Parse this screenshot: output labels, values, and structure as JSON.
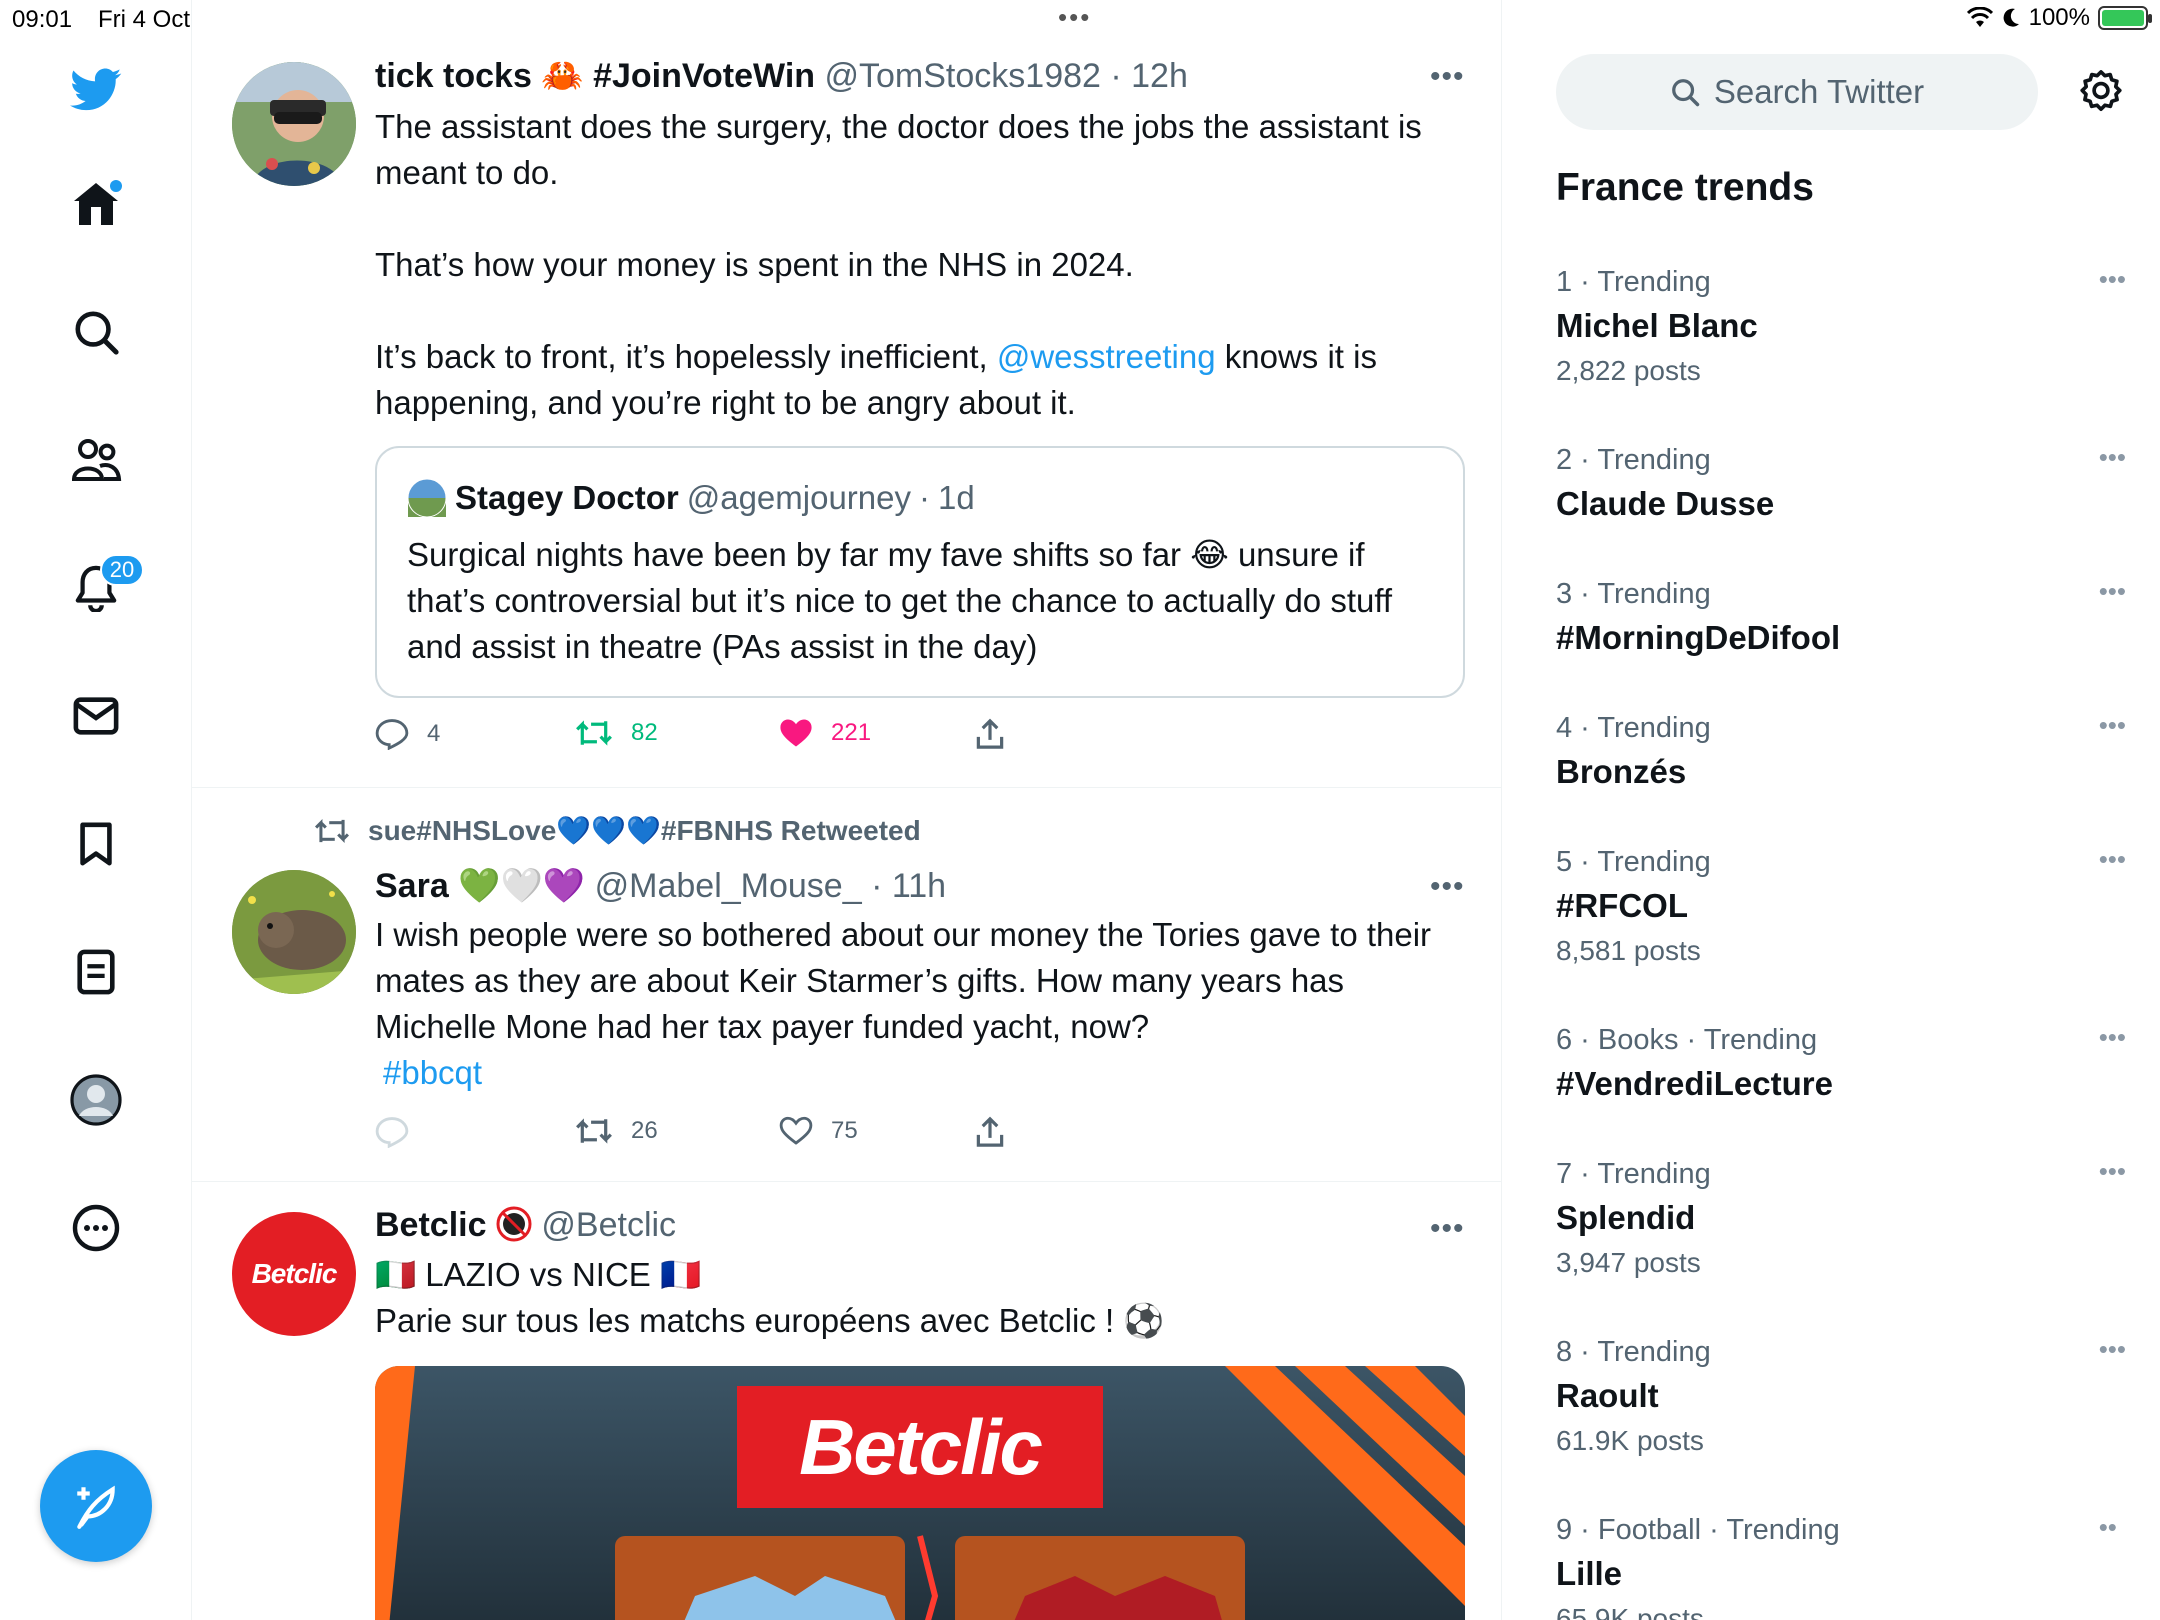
{
  "status_bar": {
    "time": "09:01",
    "date": "Fri 4 Oct",
    "battery": "100%",
    "battery_level": 1.0
  },
  "nav": {
    "notifications_badge": "20",
    "items": [
      "home-icon",
      "explore-icon",
      "communities-icon",
      "notifications-icon",
      "messages-icon",
      "bookmarks-icon",
      "lists-icon",
      "profile-icon",
      "more-icon"
    ]
  },
  "tweets": [
    {
      "name": "tick tocks 🦀 #JoinVoteWin",
      "handle": "@TomStocks1982",
      "time": "12h",
      "text_1": "The assistant does the surgery, the doctor does the jobs the assistant is meant to do.",
      "text_2": "That’s how your money is spent in the NHS in 2024.",
      "text_3a": "It’s back to front, it’s hopelessly inefficient, ",
      "mention": "@wesstreeting",
      "text_3b": " knows it is happening, and you’re right to be angry about it.",
      "quote": {
        "name": "Stagey Doctor",
        "handle": "@agemjourney",
        "time": "1d",
        "text": "Surgical nights have been by far my fave shifts so far 😂 unsure if that’s controversial but it’s nice to get the chance to actually do stuff and assist in theatre (PAs assist in the day)"
      },
      "replies": "4",
      "retweets": "82",
      "likes": "221"
    },
    {
      "retweeted_by": "sue#NHSLove💙💙💙#FBNHS Retweeted",
      "name": "Sara 💚🤍💜",
      "handle": "@Mabel_Mouse_",
      "time": "11h",
      "text": "I wish people were so bothered about our money the Tories  gave to their mates as they are about Keir Starmer’s gifts.   How many years has Michelle Mone had her tax payer funded yacht, now?",
      "hashtag": "#bbcqt",
      "replies": "",
      "retweets": "26",
      "likes": "75"
    },
    {
      "name": "Betclic",
      "handle": "@Betclic",
      "line_1": "🇮🇹 LAZIO vs NICE 🇫🇷",
      "line_2": "Parie sur tous les matchs européens avec Betclic ! ⚽",
      "avatar_logo": "Betclic",
      "media_logo": "Betclic"
    }
  ],
  "right": {
    "search_placeholder": "Search Twitter",
    "trends_title": "France trends",
    "trends": [
      {
        "meta": "1 · Trending",
        "name": "Michel Blanc",
        "posts": "2,822 posts"
      },
      {
        "meta": "2 · Trending",
        "name": "Claude Dusse",
        "posts": ""
      },
      {
        "meta": "3 · Trending",
        "name": "#MorningDeDifool",
        "posts": ""
      },
      {
        "meta": "4 · Trending",
        "name": "Bronzés",
        "posts": ""
      },
      {
        "meta": "5 · Trending",
        "name": "#RFCOL",
        "posts": "8,581 posts"
      },
      {
        "meta": "6 · Books · Trending",
        "name": "#VendrediLecture",
        "posts": ""
      },
      {
        "meta": "7 · Trending",
        "name": "Splendid",
        "posts": "3,947 posts"
      },
      {
        "meta": "8 · Trending",
        "name": "Raoult",
        "posts": "61.9K posts"
      },
      {
        "meta": "9 · Football · Trending",
        "name": "Lille",
        "posts": "65.9K posts"
      }
    ]
  },
  "colors": {
    "accent": "#1d9bf0",
    "retweet": "#00ba7c",
    "like": "#f91880",
    "betclic_red": "#e31e24"
  }
}
